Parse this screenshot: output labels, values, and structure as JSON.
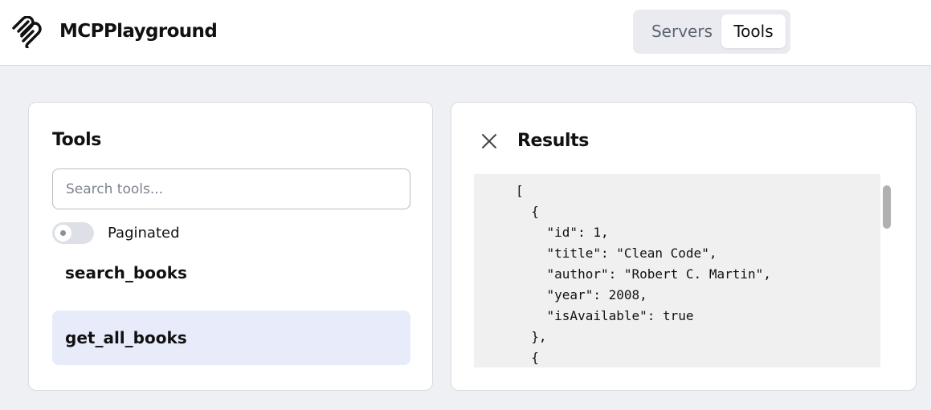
{
  "app": {
    "brand": "MCPPlayground"
  },
  "nav": {
    "tabs": [
      {
        "label": "Servers"
      },
      {
        "label": "Tools"
      }
    ],
    "active": "Tools"
  },
  "tools_panel": {
    "title": "Tools",
    "search_placeholder": "Search tools...",
    "search_value": "",
    "paginated_label": "Paginated",
    "paginated_on": false,
    "items": [
      {
        "name": "search_books"
      },
      {
        "name": "get_all_books"
      }
    ],
    "selected": "get_all_books"
  },
  "results_panel": {
    "title": "Results",
    "lines": [
      "[",
      "  {",
      "    \"id\": 1,",
      "    \"title\": \"Clean Code\",",
      "    \"author\": \"Robert C. Martin\",",
      "    \"year\": 2008,",
      "    \"isAvailable\": true",
      "  },",
      "  {"
    ]
  },
  "icons": {
    "logo": "mcp-logo-icon",
    "close": "close-icon"
  },
  "colors": {
    "selected_item": "#e8ecfa",
    "background": "#eef0f4"
  }
}
